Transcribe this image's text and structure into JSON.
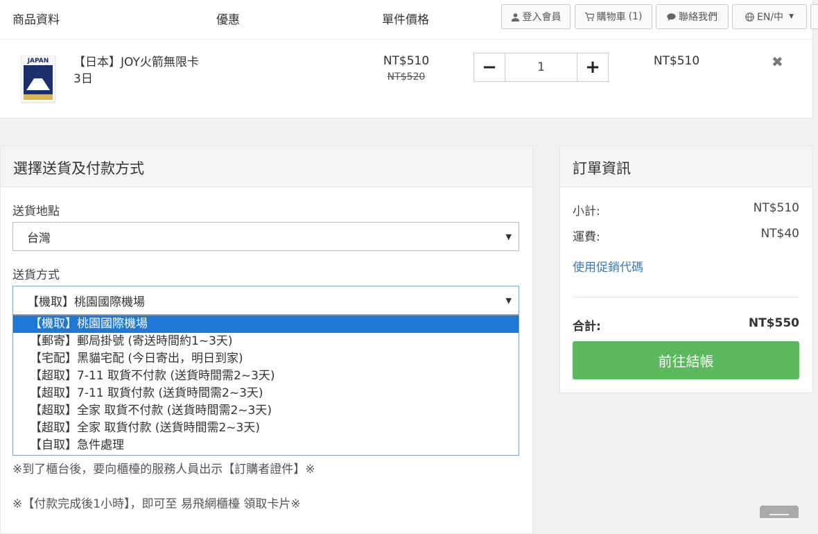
{
  "header": {
    "col_product": "商品資料",
    "col_discount": "優惠",
    "col_unit_price": "單件價格",
    "btn_login": "登入會員",
    "btn_cart": "購物車",
    "cart_count": "(1)",
    "btn_contact": "聯絡我們",
    "btn_lang": "EN/中"
  },
  "item": {
    "name": "【日本】JOY火箭無限卡 3日",
    "thumb_text": "JAPAN",
    "price": "NT$510",
    "price_original": "NT$520",
    "quantity": "1",
    "qty_minus": "−",
    "qty_plus": "+",
    "total": "NT$510",
    "remove_icon": "✖"
  },
  "shipping": {
    "title": "選擇送貨及付款方式",
    "location_label": "送貨地點",
    "location_value": "台灣",
    "method_label": "送貨方式",
    "method_value": "【機取】桃園國際機場",
    "options": [
      "【機取】桃園國際機場",
      "【郵寄】郵局掛號 (寄送時間約1~3天)",
      "【宅配】黑貓宅配 (今日寄出，明日到家)",
      "【超取】7-11 取貨不付款 (送貨時間需2~3天)",
      "【超取】7-11 取貨付款 (送貨時間需2~3天)",
      "【超取】全家 取貨不付款 (送貨時間需2~3天)",
      "【超取】全家 取貨付款 (送貨時間需2~3天)",
      "【自取】急件處理"
    ],
    "selected_index": 0,
    "note1": "※到了櫃台後，要向櫃檯的服務人員出示【訂購者證件】※",
    "note2": "※【付款完成後1小時】，即可至 易飛網櫃檯 領取卡片※"
  },
  "order": {
    "title": "訂單資訊",
    "subtotal_label": "小計:",
    "subtotal_value": "NT$510",
    "shipping_label": "運費:",
    "shipping_value": "NT$40",
    "promo_link": "使用促銷代碼",
    "total_label": "合計:",
    "total_value": "NT$550",
    "checkout_label": "前往結帳"
  },
  "colors": {
    "accent_green": "#5cb85c",
    "link_blue": "#3a7ab8",
    "selected_option": "#1e78d6"
  }
}
